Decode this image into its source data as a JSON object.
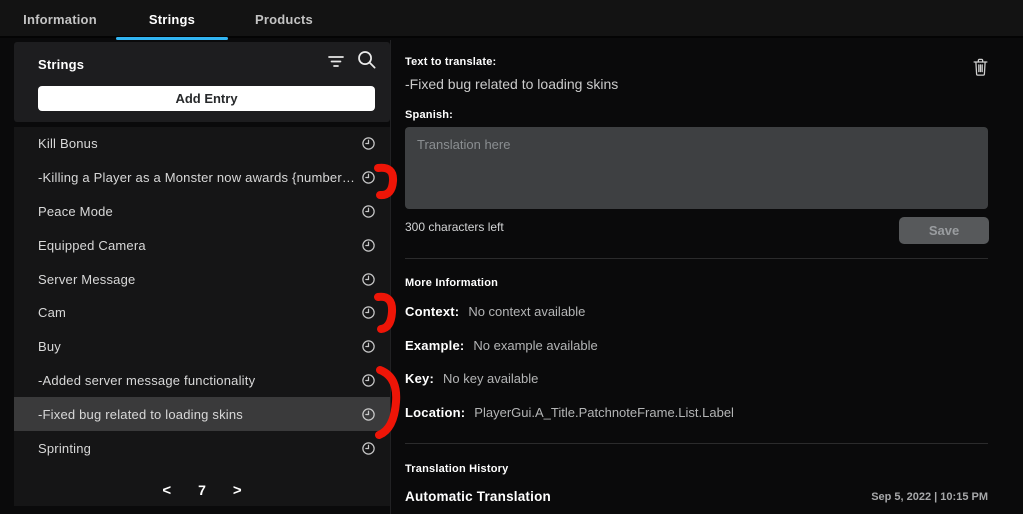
{
  "tabs": [
    {
      "label": "Information",
      "active": false
    },
    {
      "label": "Strings",
      "active": true
    },
    {
      "label": "Products",
      "active": false
    }
  ],
  "left_panel": {
    "title": "Strings",
    "add_entry_label": "Add Entry",
    "icons": {
      "filter": "filter-icon",
      "search": "search-icon",
      "row_history": "clock-icon"
    },
    "items": [
      {
        "label": "Kill Bonus"
      },
      {
        "label": "-Killing a Player as a Monster now awards {number…"
      },
      {
        "label": "Peace Mode"
      },
      {
        "label": "Equipped Camera"
      },
      {
        "label": "Server Message"
      },
      {
        "label": "Cam"
      },
      {
        "label": "Buy"
      },
      {
        "label": "-Added server message functionality"
      },
      {
        "label": "-Fixed bug related to loading skins",
        "selected": true
      },
      {
        "label": "Sprinting"
      }
    ],
    "pagination": {
      "prev": "<",
      "page": "7",
      "next": ">"
    }
  },
  "detail": {
    "text_to_translate_label": "Text to translate:",
    "text_to_translate": "-Fixed bug related to loading skins",
    "delete_icon": "trash-icon",
    "language_label": "Spanish:",
    "translation_placeholder": "Translation here",
    "translation_value": "",
    "characters_left": "300 characters left",
    "save_label": "Save",
    "more_information": {
      "heading": "More Information",
      "rows": [
        {
          "label": "Context:",
          "value": "No context available"
        },
        {
          "label": "Example:",
          "value": "No example available"
        },
        {
          "label": "Key:",
          "value": "No key available"
        },
        {
          "label": "Location:",
          "value": "PlayerGui.A_Title.PatchnoteFrame.List.Label"
        }
      ]
    },
    "history": {
      "heading": "Translation History",
      "entry_title": "Automatic Translation",
      "entry_date": "Sep 5, 2022 | 10:15 PM"
    }
  },
  "colors": {
    "accent": "#31B4F2",
    "annotation_red": "#EE1507",
    "selected_row": "#3a3a3b"
  }
}
